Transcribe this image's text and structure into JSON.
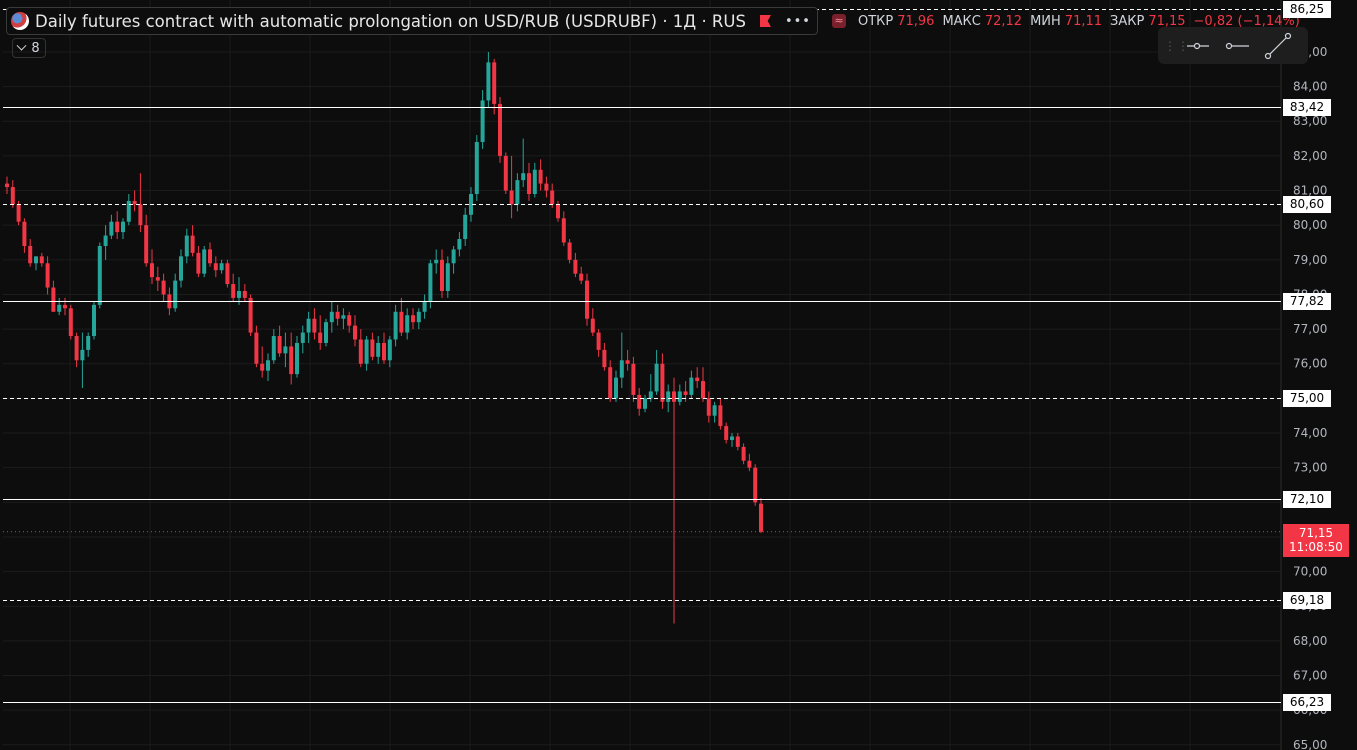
{
  "header": {
    "title": "Daily futures contract with automatic prolongation on USD/RUB (USDRUBF) · 1Д · RUS",
    "more_label": "•••",
    "market_icon": "≈",
    "open_label": "ОТКР",
    "open_value": "71,96",
    "high_label": "МАКС",
    "high_value": "72,12",
    "low_label": "МИН",
    "low_value": "71,11",
    "close_label": "ЗАКР",
    "close_value": "71,15",
    "change": "−0,82 (−1,14%)"
  },
  "indicators_toggle": {
    "count": "8"
  },
  "drawing_toolbar": {
    "icons": [
      "drag-handle-icon",
      "horizontal-ray-icon",
      "horizontal-line-icon",
      "trend-line-icon"
    ]
  },
  "colors": {
    "up": "#26a69a",
    "down": "#f23645",
    "background": "#0d0d0d",
    "grid": "#1c1c1c",
    "level_line": "#ffffff"
  },
  "price_axis": {
    "ticks": [
      "85,00",
      "84,00",
      "83,00",
      "82,00",
      "81,00",
      "80,00",
      "79,00",
      "78,00",
      "77,00",
      "76,00",
      "75,00",
      "74,00",
      "73,00",
      "72,00",
      "71,00",
      "70,00",
      "69,00",
      "68,00",
      "67,00",
      "66,00",
      "65,00"
    ]
  },
  "levels": [
    {
      "label": "86,25",
      "style": "dashed"
    },
    {
      "label": "83,42",
      "style": "solid"
    },
    {
      "label": "80,60",
      "style": "dashed"
    },
    {
      "label": "77,82",
      "style": "solid"
    },
    {
      "label": "75,00",
      "style": "dashed"
    },
    {
      "label": "72,10",
      "style": "solid"
    },
    {
      "label": "69,18",
      "style": "dashed"
    },
    {
      "label": "66,23",
      "style": "solid"
    }
  ],
  "current_price": {
    "price": "71,15",
    "countdown": "11:08:50"
  },
  "chart_data": {
    "type": "candlestick",
    "y_range": [
      64.85,
      86.5
    ],
    "candles": [
      [
        81.2,
        81.4,
        80.9,
        81.1
      ],
      [
        81.1,
        81.3,
        80.5,
        80.6
      ],
      [
        80.6,
        80.7,
        80.0,
        80.1
      ],
      [
        80.1,
        80.2,
        79.2,
        79.4
      ],
      [
        79.4,
        79.6,
        78.8,
        78.9
      ],
      [
        78.9,
        79.1,
        78.7,
        79.1
      ],
      [
        79.1,
        79.2,
        78.8,
        78.9
      ],
      [
        78.9,
        79.1,
        78.0,
        78.2
      ],
      [
        78.2,
        78.4,
        77.5,
        77.5
      ],
      [
        77.5,
        77.9,
        77.4,
        77.7
      ],
      [
        77.7,
        77.9,
        77.4,
        77.6
      ],
      [
        77.6,
        77.7,
        76.7,
        76.8
      ],
      [
        76.8,
        76.9,
        75.9,
        76.1
      ],
      [
        76.1,
        76.9,
        75.3,
        76.4
      ],
      [
        76.4,
        76.9,
        76.2,
        76.8
      ],
      [
        76.8,
        77.8,
        76.7,
        77.7
      ],
      [
        77.7,
        79.5,
        77.6,
        79.4
      ],
      [
        79.4,
        80.0,
        79.0,
        79.7
      ],
      [
        79.7,
        80.3,
        79.6,
        80.1
      ],
      [
        80.1,
        80.4,
        79.6,
        79.8
      ],
      [
        79.8,
        80.2,
        79.6,
        80.1
      ],
      [
        80.1,
        80.9,
        80.0,
        80.7
      ],
      [
        80.7,
        81.0,
        80.4,
        80.6
      ],
      [
        80.6,
        81.5,
        79.8,
        80.0
      ],
      [
        80.0,
        80.3,
        78.8,
        78.9
      ],
      [
        78.9,
        79.3,
        78.3,
        78.5
      ],
      [
        78.5,
        78.8,
        78.1,
        78.4
      ],
      [
        78.4,
        78.6,
        77.8,
        78.0
      ],
      [
        78.0,
        78.2,
        77.4,
        77.6
      ],
      [
        77.6,
        78.6,
        77.5,
        78.4
      ],
      [
        78.4,
        79.3,
        78.2,
        79.1
      ],
      [
        79.1,
        79.9,
        78.9,
        79.7
      ],
      [
        79.7,
        80.0,
        79.1,
        79.2
      ],
      [
        79.2,
        79.4,
        78.5,
        78.6
      ],
      [
        78.6,
        79.4,
        78.5,
        79.3
      ],
      [
        79.3,
        79.5,
        78.8,
        78.9
      ],
      [
        78.9,
        79.1,
        78.5,
        78.7
      ],
      [
        78.7,
        79.0,
        78.6,
        78.9
      ],
      [
        78.9,
        79.0,
        78.2,
        78.3
      ],
      [
        78.3,
        78.6,
        77.8,
        77.9
      ],
      [
        77.9,
        78.5,
        77.7,
        78.1
      ],
      [
        78.1,
        78.3,
        77.8,
        77.9
      ],
      [
        77.9,
        78.0,
        76.8,
        76.9
      ],
      [
        76.9,
        77.1,
        75.9,
        76.0
      ],
      [
        76.0,
        76.5,
        75.6,
        75.8
      ],
      [
        75.8,
        76.3,
        75.5,
        76.1
      ],
      [
        76.1,
        77.0,
        76.0,
        76.8
      ],
      [
        76.8,
        77.1,
        76.2,
        76.3
      ],
      [
        76.3,
        76.9,
        75.9,
        76.5
      ],
      [
        76.5,
        76.9,
        75.4,
        75.7
      ],
      [
        75.7,
        76.8,
        75.6,
        76.6
      ],
      [
        76.6,
        77.1,
        76.3,
        76.9
      ],
      [
        76.9,
        77.5,
        76.6,
        77.3
      ],
      [
        77.3,
        77.6,
        76.7,
        76.9
      ],
      [
        76.9,
        77.4,
        76.4,
        76.6
      ],
      [
        76.6,
        77.3,
        76.5,
        77.2
      ],
      [
        77.2,
        77.8,
        76.9,
        77.5
      ],
      [
        77.5,
        77.7,
        77.1,
        77.3
      ],
      [
        77.3,
        77.6,
        77.0,
        77.4
      ],
      [
        77.4,
        77.5,
        76.9,
        77.1
      ],
      [
        77.1,
        77.4,
        76.5,
        76.7
      ],
      [
        76.7,
        77.0,
        75.9,
        76.0
      ],
      [
        76.0,
        76.8,
        75.8,
        76.7
      ],
      [
        76.7,
        76.9,
        76.1,
        76.2
      ],
      [
        76.2,
        76.8,
        76.0,
        76.6
      ],
      [
        76.6,
        76.9,
        76.0,
        76.1
      ],
      [
        76.1,
        76.8,
        75.9,
        76.7
      ],
      [
        76.7,
        77.7,
        76.5,
        77.5
      ],
      [
        77.5,
        77.9,
        76.8,
        76.9
      ],
      [
        76.9,
        77.6,
        76.7,
        77.4
      ],
      [
        77.4,
        77.6,
        77.0,
        77.2
      ],
      [
        77.2,
        77.6,
        77.0,
        77.5
      ],
      [
        77.5,
        78.0,
        77.3,
        77.8
      ],
      [
        77.8,
        79.0,
        77.6,
        78.9
      ],
      [
        78.9,
        79.3,
        78.6,
        79.0
      ],
      [
        79.0,
        79.3,
        77.9,
        78.1
      ],
      [
        78.1,
        79.1,
        77.9,
        78.9
      ],
      [
        78.9,
        79.4,
        78.6,
        79.3
      ],
      [
        79.3,
        79.8,
        79.1,
        79.6
      ],
      [
        79.6,
        80.5,
        79.4,
        80.3
      ],
      [
        80.3,
        81.1,
        80.1,
        80.9
      ],
      [
        80.9,
        82.6,
        80.7,
        82.4
      ],
      [
        82.4,
        83.9,
        82.2,
        83.6
      ],
      [
        83.6,
        85.0,
        83.4,
        84.7
      ],
      [
        84.7,
        84.8,
        83.2,
        83.5
      ],
      [
        83.5,
        83.7,
        81.8,
        82.0
      ],
      [
        82.0,
        82.1,
        80.9,
        81.0
      ],
      [
        81.0,
        82.0,
        80.2,
        80.6
      ],
      [
        80.6,
        81.5,
        80.4,
        81.3
      ],
      [
        81.3,
        82.5,
        81.1,
        81.5
      ],
      [
        81.5,
        81.8,
        80.7,
        80.9
      ],
      [
        80.9,
        81.8,
        80.8,
        81.6
      ],
      [
        81.6,
        81.9,
        81.0,
        81.2
      ],
      [
        81.2,
        81.4,
        80.8,
        81.0
      ],
      [
        81.0,
        81.2,
        80.5,
        80.6
      ],
      [
        80.6,
        80.7,
        80.1,
        80.2
      ],
      [
        80.2,
        80.4,
        79.4,
        79.5
      ],
      [
        79.5,
        79.6,
        78.9,
        79.0
      ],
      [
        79.0,
        79.2,
        78.5,
        78.6
      ],
      [
        78.6,
        78.8,
        78.3,
        78.4
      ],
      [
        78.4,
        78.6,
        77.1,
        77.3
      ],
      [
        77.3,
        77.6,
        76.8,
        76.9
      ],
      [
        76.9,
        77.0,
        76.2,
        76.4
      ],
      [
        76.4,
        76.6,
        75.8,
        75.9
      ],
      [
        75.9,
        76.1,
        74.9,
        75.0
      ],
      [
        75.0,
        75.8,
        74.9,
        75.6
      ],
      [
        75.6,
        76.9,
        75.3,
        76.1
      ],
      [
        76.1,
        76.4,
        75.8,
        76.0
      ],
      [
        76.0,
        76.2,
        74.9,
        75.1
      ],
      [
        75.1,
        75.3,
        74.5,
        74.7
      ],
      [
        74.7,
        75.1,
        74.6,
        75.0
      ],
      [
        75.0,
        75.7,
        74.9,
        75.2
      ],
      [
        75.2,
        76.4,
        75.1,
        76.0
      ],
      [
        76.0,
        76.3,
        74.7,
        74.9
      ],
      [
        74.9,
        75.4,
        74.6,
        75.2
      ],
      [
        75.2,
        75.6,
        68.5,
        74.9
      ],
      [
        74.9,
        75.4,
        74.8,
        75.2
      ],
      [
        75.2,
        75.5,
        74.9,
        75.1
      ],
      [
        75.1,
        75.8,
        75.0,
        75.6
      ],
      [
        75.6,
        75.9,
        75.3,
        75.5
      ],
      [
        75.5,
        75.9,
        74.9,
        75.0
      ],
      [
        75.0,
        75.2,
        74.3,
        74.5
      ],
      [
        74.5,
        74.9,
        74.3,
        74.8
      ],
      [
        74.8,
        75.0,
        74.1,
        74.2
      ],
      [
        74.2,
        74.3,
        73.7,
        73.8
      ],
      [
        73.8,
        74.0,
        73.6,
        73.9
      ],
      [
        73.9,
        74.0,
        73.5,
        73.6
      ],
      [
        73.6,
        73.7,
        73.1,
        73.2
      ],
      [
        73.2,
        73.4,
        72.9,
        73.0
      ],
      [
        73.0,
        73.1,
        71.9,
        72.0
      ],
      [
        71.96,
        72.12,
        71.11,
        71.15
      ]
    ]
  }
}
